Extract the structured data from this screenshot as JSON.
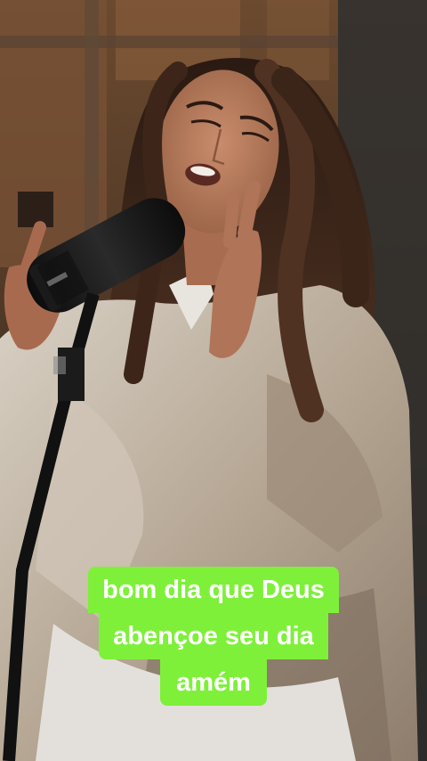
{
  "caption": {
    "lines": [
      "bom dia que Deus",
      "abençoe seu dia",
      "amém"
    ],
    "background_color": "#7ef03a",
    "text_color": "#ffffff"
  }
}
